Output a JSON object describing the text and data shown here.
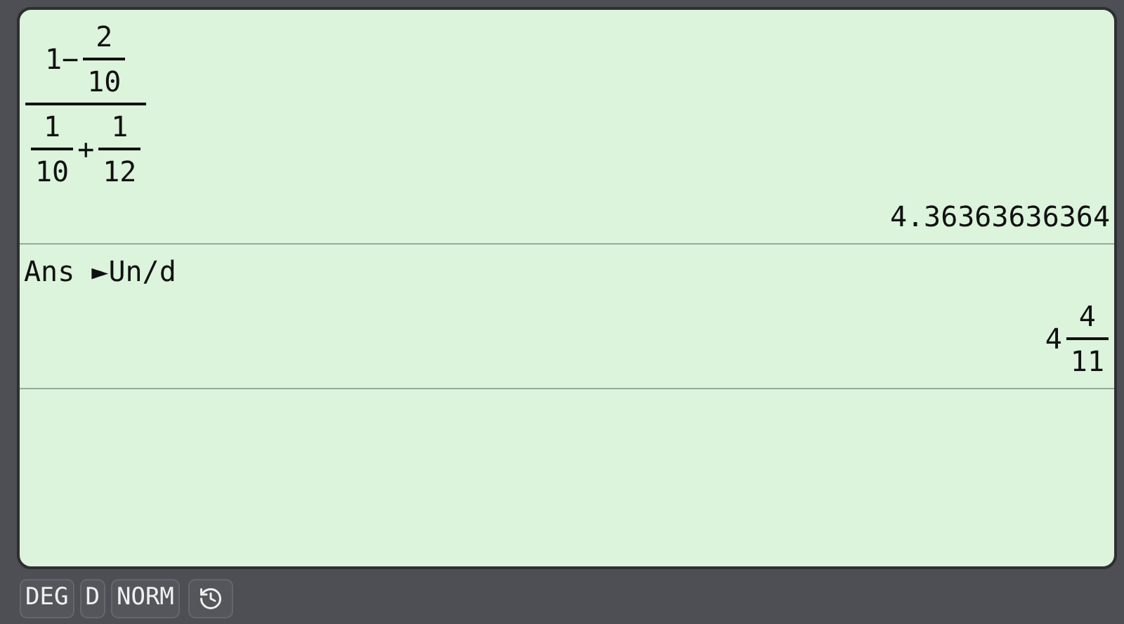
{
  "history": [
    {
      "input": [
        {
          "kind": "frac",
          "num": [
            {
              "kind": "text",
              "text": "1−"
            },
            {
              "kind": "frac",
              "num": [
                {
                  "kind": "text",
                  "text": "2"
                }
              ],
              "den": [
                {
                  "kind": "text",
                  "text": "10"
                }
              ]
            }
          ],
          "den": [
            {
              "kind": "frac",
              "num": [
                {
                  "kind": "text",
                  "text": "1"
                }
              ],
              "den": [
                {
                  "kind": "text",
                  "text": "10"
                }
              ]
            },
            {
              "kind": "text",
              "text": "+"
            },
            {
              "kind": "frac",
              "num": [
                {
                  "kind": "text",
                  "text": "1"
                }
              ],
              "den": [
                {
                  "kind": "text",
                  "text": "12"
                }
              ]
            }
          ]
        }
      ],
      "output": [
        {
          "kind": "text",
          "text": "4.36363636364"
        }
      ]
    },
    {
      "input": [
        {
          "kind": "text",
          "text": "Ans ►Un/d"
        }
      ],
      "output": [
        {
          "kind": "text",
          "text": "4"
        },
        {
          "kind": "frac",
          "num": [
            {
              "kind": "text",
              "text": "4"
            }
          ],
          "den": [
            {
              "kind": "text",
              "text": "11"
            }
          ]
        }
      ]
    }
  ],
  "status_bar": [
    {
      "kind": "text",
      "label": "DEG"
    },
    {
      "kind": "text",
      "label": "D"
    },
    {
      "kind": "text",
      "label": "NORM"
    },
    {
      "kind": "history"
    }
  ]
}
